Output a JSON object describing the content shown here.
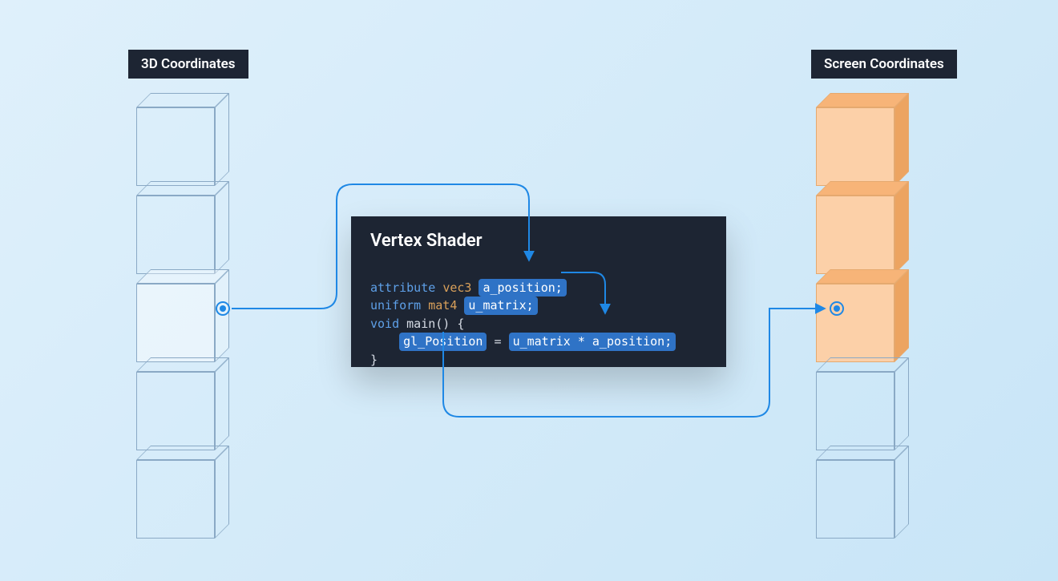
{
  "labels": {
    "left": "3D Coordinates",
    "right": "Screen Coordinates"
  },
  "panel": {
    "title": "Vertex Shader",
    "code": {
      "line1": {
        "kw": "attribute",
        "type": "vec3",
        "var": "a_position;"
      },
      "line2": {
        "kw": "uniform",
        "type": "mat4",
        "var": "u_matrix;"
      },
      "line3": {
        "kw": "void",
        "func": "main()",
        "brace_open": "{"
      },
      "line4": {
        "indent": "    ",
        "gl": "gl_Position",
        "eq": " = ",
        "expr": "u_matrix * a_position;"
      },
      "line5": {
        "brace_close": "}"
      }
    }
  },
  "colors": {
    "panel_bg": "#1d2533",
    "accent_blue": "#1f88e5",
    "cube_orange_face": "#fcd0a8",
    "cube_orange_top": "#f7b478",
    "cube_orange_side": "#eca461",
    "wire_stroke": "#8aa9c5"
  },
  "left_stack": [
    {
      "kind": "wire"
    },
    {
      "kind": "wire"
    },
    {
      "kind": "wire",
      "highlight": true,
      "dot": true
    },
    {
      "kind": "wire"
    },
    {
      "kind": "wire"
    }
  ],
  "right_stack": [
    {
      "kind": "solid"
    },
    {
      "kind": "solid"
    },
    {
      "kind": "solid",
      "dot": true
    },
    {
      "kind": "wire"
    },
    {
      "kind": "wire"
    }
  ]
}
